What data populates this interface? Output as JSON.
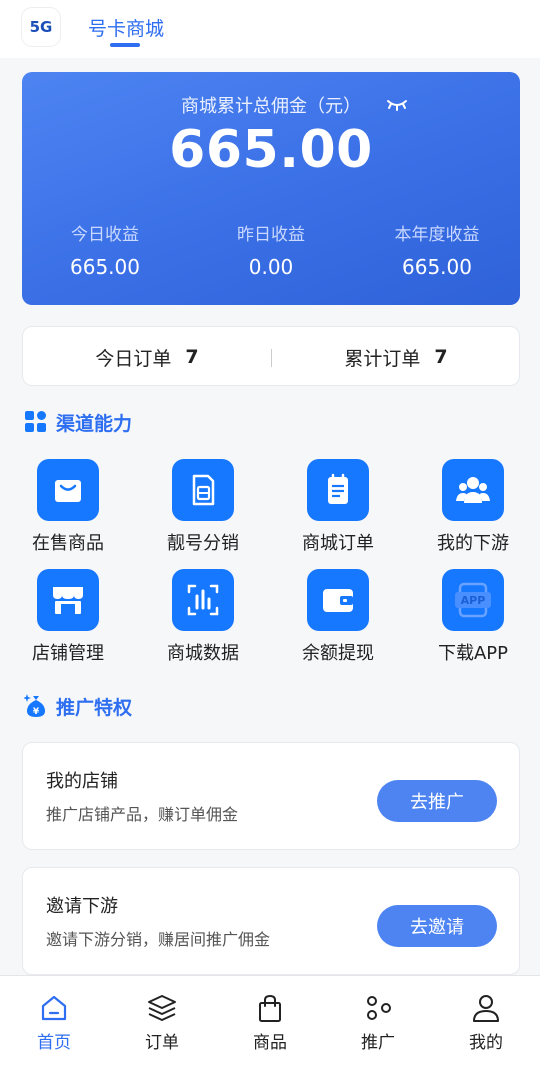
{
  "header": {
    "logo_text": "5G",
    "title": "号卡商城"
  },
  "summary": {
    "label": "商城累计总佣金（元）",
    "amount": "665.00",
    "stats": [
      {
        "label": "今日收益",
        "value": "665.00"
      },
      {
        "label": "昨日收益",
        "value": "0.00"
      },
      {
        "label": "本年度收益",
        "value": "665.00"
      }
    ]
  },
  "orders": {
    "today_label": "今日订单",
    "today_count": "7",
    "total_label": "累计订单",
    "total_count": "7"
  },
  "channel": {
    "title": "渠道能力",
    "items": [
      {
        "label": "在售商品",
        "icon": "shopping-bag-icon"
      },
      {
        "label": "靓号分销",
        "icon": "sim-card-icon"
      },
      {
        "label": "商城订单",
        "icon": "order-list-icon"
      },
      {
        "label": "我的下游",
        "icon": "team-icon"
      },
      {
        "label": "店铺管理",
        "icon": "store-icon"
      },
      {
        "label": "商城数据",
        "icon": "data-chart-icon"
      },
      {
        "label": "余额提现",
        "icon": "wallet-icon"
      },
      {
        "label": "下载APP",
        "icon": "app-download-icon"
      }
    ]
  },
  "promotion": {
    "title": "推广特权",
    "cards": [
      {
        "title": "我的店铺",
        "desc": "推广店铺产品，赚订单佣金",
        "button": "去推广"
      },
      {
        "title": "邀请下游",
        "desc": "邀请下游分销，赚居间推广佣金",
        "button": "去邀请"
      }
    ]
  },
  "bottom_nav": [
    {
      "label": "首页",
      "icon": "home-icon",
      "active": true
    },
    {
      "label": "订单",
      "icon": "layers-icon",
      "active": false
    },
    {
      "label": "商品",
      "icon": "bag-icon",
      "active": false
    },
    {
      "label": "推广",
      "icon": "share-dots-icon",
      "active": false
    },
    {
      "label": "我的",
      "icon": "user-icon",
      "active": false
    }
  ],
  "colors": {
    "accent": "#2e6ef0",
    "icon_blue": "#1677ff",
    "card_gradient_start": "#4d84f2",
    "card_gradient_end": "#2f62d9"
  }
}
